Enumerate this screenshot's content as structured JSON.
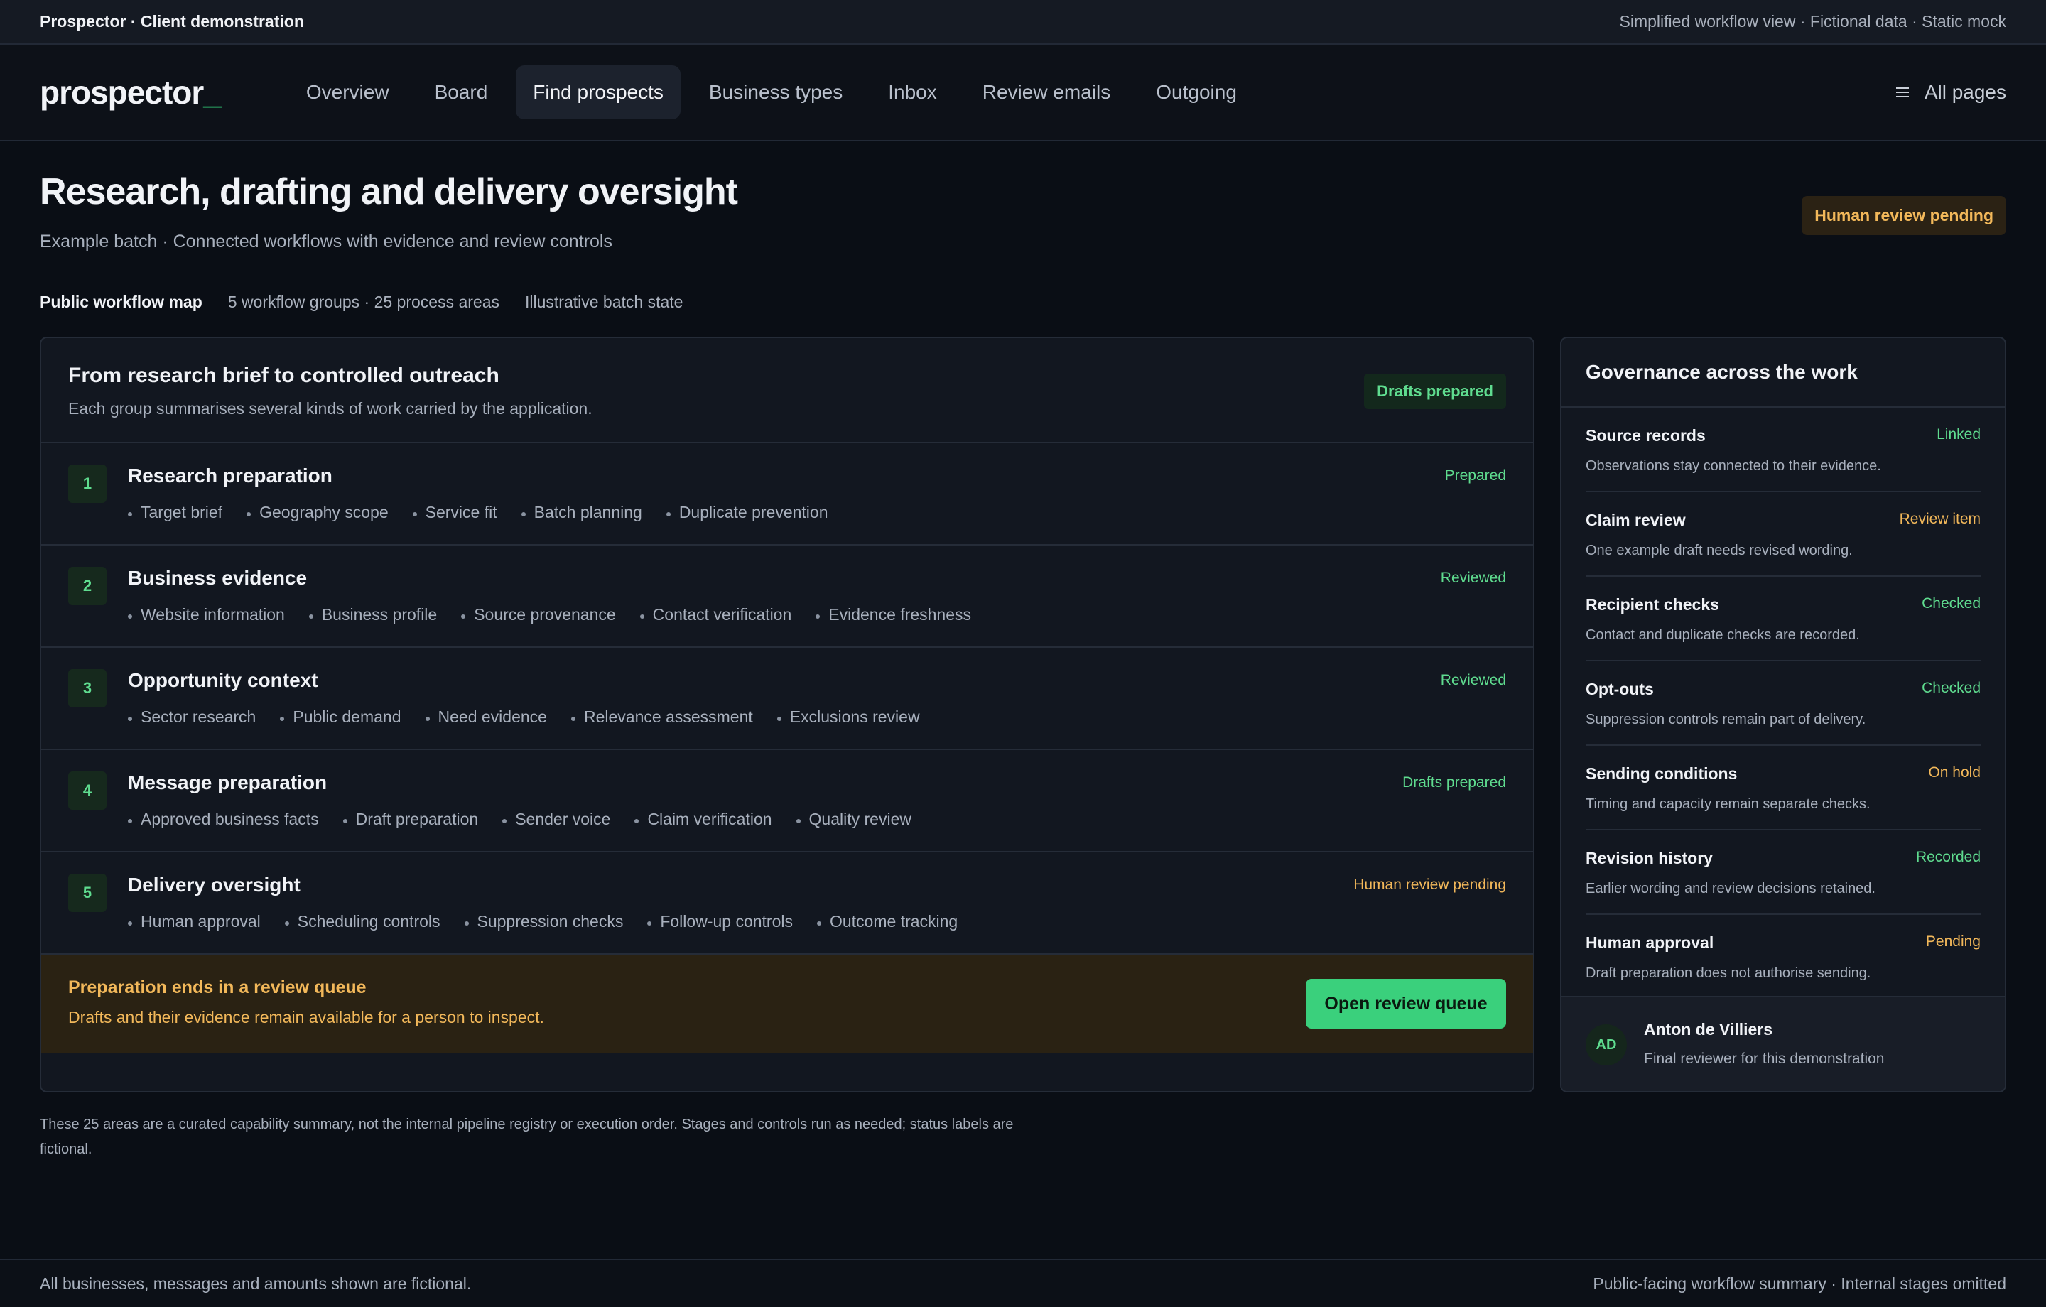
{
  "topbar": {
    "app_title": "Prospector · Client demonstration",
    "meta": "Simplified workflow view · Fictional data · Static mock"
  },
  "nav": {
    "logo": "prospector",
    "logo_cursor": "_",
    "links": [
      "Overview",
      "Board",
      "Find prospects",
      "Business types",
      "Inbox",
      "Review emails",
      "Outgoing"
    ],
    "active": "Find prospects",
    "all_pages": "All pages",
    "all_pages_icon": "menu-icon"
  },
  "header": {
    "title": "Research, drafting and delivery oversight",
    "subtitle": "Example batch · Connected workflows with evidence and review controls",
    "badge": "Human review pending",
    "meta": [
      "Public workflow map",
      "5 workflow groups · 25 process areas",
      "Illustrative batch state"
    ]
  },
  "workflow": {
    "title": "From research brief to controlled outreach",
    "description": "Each group summarises several kinds of work carried by the application.",
    "badge": "Drafts prepared",
    "steps": [
      {
        "num": "1",
        "title": "Research preparation",
        "status": "Prepared",
        "tone": "green",
        "items": [
          "Target brief",
          "Geography scope",
          "Service fit",
          "Batch planning",
          "Duplicate prevention"
        ]
      },
      {
        "num": "2",
        "title": "Business evidence",
        "status": "Reviewed",
        "tone": "green",
        "items": [
          "Website information",
          "Business profile",
          "Source provenance",
          "Contact verification",
          "Evidence freshness"
        ]
      },
      {
        "num": "3",
        "title": "Opportunity context",
        "status": "Reviewed",
        "tone": "green",
        "items": [
          "Sector research",
          "Public demand",
          "Need evidence",
          "Relevance assessment",
          "Exclusions review"
        ]
      },
      {
        "num": "4",
        "title": "Message preparation",
        "status": "Drafts prepared",
        "tone": "green",
        "items": [
          "Approved business facts",
          "Draft preparation",
          "Sender voice",
          "Claim verification",
          "Quality review"
        ]
      },
      {
        "num": "5",
        "title": "Delivery oversight",
        "status": "Human review pending",
        "tone": "amber",
        "items": [
          "Human approval",
          "Scheduling controls",
          "Suppression checks",
          "Follow-up controls",
          "Outcome tracking"
        ]
      }
    ],
    "queue": {
      "title": "Preparation ends in a review queue",
      "text": "Drafts and their evidence remain available for a person to inspect.",
      "button": "Open review queue"
    }
  },
  "governance": {
    "title": "Governance across the work",
    "items": [
      {
        "name": "Source records",
        "status": "Linked",
        "tone": "green",
        "desc": "Observations stay connected to their evidence."
      },
      {
        "name": "Claim review",
        "status": "Review item",
        "tone": "amber",
        "desc": "One example draft needs revised wording."
      },
      {
        "name": "Recipient checks",
        "status": "Checked",
        "tone": "green",
        "desc": "Contact and duplicate checks are recorded."
      },
      {
        "name": "Opt-outs",
        "status": "Checked",
        "tone": "green",
        "desc": "Suppression controls remain part of delivery."
      },
      {
        "name": "Sending conditions",
        "status": "On hold",
        "tone": "amber",
        "desc": "Timing and capacity remain separate checks."
      },
      {
        "name": "Revision history",
        "status": "Recorded",
        "tone": "green",
        "desc": "Earlier wording and review decisions retained."
      },
      {
        "name": "Human approval",
        "status": "Pending",
        "tone": "amber",
        "desc": "Draft preparation does not authorise sending."
      }
    ],
    "reviewer": {
      "initials": "AD",
      "name": "Anton de Villiers",
      "role": "Final reviewer for this demonstration"
    }
  },
  "note": "These 25 areas are a curated capability summary, not the internal pipeline registry or execution order. Stages and controls run as needed; status labels are fictional.",
  "footer": {
    "left": "All businesses, messages and amounts shown are fictional.",
    "right": "Public-facing workflow summary · Internal stages omitted"
  },
  "colors": {
    "background": "#0a0e15",
    "accent_green": "#3ad07c",
    "status_green": "#5fdc8f",
    "status_amber": "#f2b85a"
  }
}
